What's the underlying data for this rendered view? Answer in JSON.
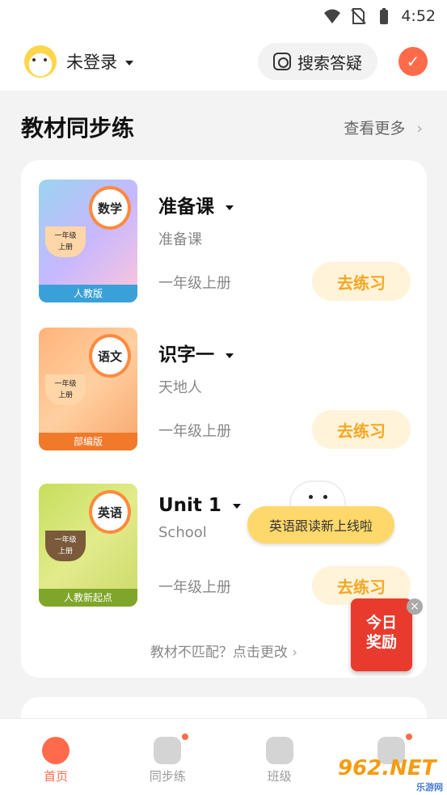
{
  "status_bar": {
    "time": "4:52"
  },
  "header": {
    "login_status": "未登录",
    "search_label": "搜索答疑"
  },
  "section": {
    "title": "教材同步练",
    "see_more": "查看更多"
  },
  "books": [
    {
      "subject": "数学",
      "grade_badge": "一年级\n上册",
      "publisher": "人教版",
      "title": "准备课",
      "subtitle": "准备课",
      "grade": "一年级上册",
      "action": "去练习",
      "cover_color": "#56b7e0"
    },
    {
      "subject": "语文",
      "grade_badge": "一年级\n上册",
      "publisher": "部编版",
      "title": "识字一",
      "subtitle": "天地人",
      "grade": "一年级上册",
      "action": "去练习",
      "cover_color": "#f48c4a"
    },
    {
      "subject": "英语",
      "grade_badge": "一年级\n上册",
      "publisher": "人教新起点",
      "title": "Unit 1",
      "subtitle": "School",
      "grade": "一年级上册",
      "action": "去练习",
      "cover_color": "#a5c63b"
    }
  ],
  "mismatch_link": "教材不匹配？点击更改",
  "promo_bubble": "英语跟读新上线啦",
  "reward_badge": {
    "line1": "今日",
    "line2": "奖励"
  },
  "bottom_nav": [
    {
      "label": "首页",
      "active": true
    },
    {
      "label": "同步练",
      "active": false
    },
    {
      "label": "班级",
      "active": false
    },
    {
      "label": "",
      "active": false
    }
  ],
  "watermark": {
    "main": "962.NET",
    "sub": "乐游网"
  }
}
